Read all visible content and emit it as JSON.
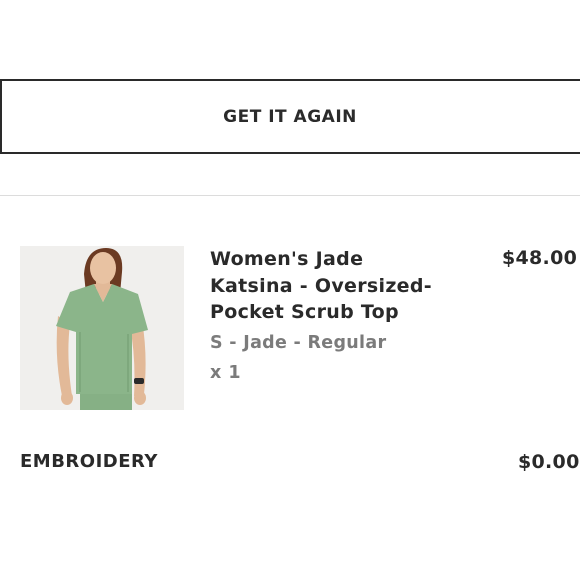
{
  "actions": {
    "get_it_again_label": "GET IT AGAIN"
  },
  "line_item": {
    "product_name": "Women's Jade Katsina - Oversized-Pocket Scrub Top",
    "product_name_lines": [
      "Women's Jade",
      "Katsina - Oversized-",
      "Pocket Scrub Top"
    ],
    "variant": "S - Jade - Regular",
    "quantity_text": "x 1",
    "price": "$48.00",
    "image_subject": "woman-in-jade-scrub-top"
  },
  "addon": {
    "label": "EMBROIDERY",
    "price": "$0.00"
  },
  "colors": {
    "scrub_jade": "#8bb58a",
    "text_dark": "#2a2a2a",
    "text_muted": "#7b7b7b"
  }
}
